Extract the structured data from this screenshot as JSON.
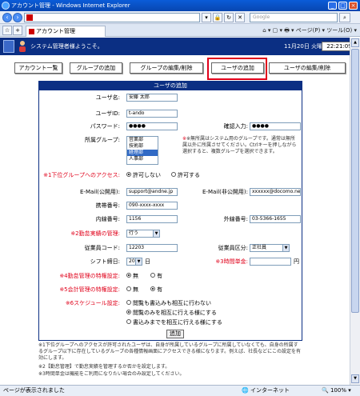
{
  "browser": {
    "title": "アカウント管理 - Windows Internet Explorer",
    "search_placeholder": "Google",
    "tab_label": "アカウント管理",
    "tools_text": "⌂ ▾ ▢ ▾ 🖶 ▾ ページ(P) ▾ ツール(O) ▾",
    "status": "ページが表示されました",
    "zone": "インターネット",
    "zoom": "100%"
  },
  "app": {
    "welcome": "システム管理者様ようこそ。",
    "date": "11月20日 火曜",
    "time": "22:21:09"
  },
  "nav": {
    "account_list": "アカウント一覧",
    "group_add": "グループの追加",
    "group_edit": "グループの編集/削除",
    "user_add": "ユーザの追加",
    "user_edit": "ユーザの編集/削除"
  },
  "form": {
    "header": "ユーザの追加",
    "username_label": "ユーザ名:",
    "username_value": "安藤 太郎",
    "userid_label": "ユーザID:",
    "userid_value": "t-ando",
    "password_label": "パスワード:",
    "password_value": "●●●●",
    "confirm_label": "確認入力:",
    "confirm_value": "●●●●",
    "group_label": "所属グループ:",
    "groups": [
      "営業部",
      "技術部",
      "経理部",
      "人事部"
    ],
    "group_note": "※無所属はシステム用のグループです。通常は無所属以外に所属させてください。Ctrlキーを押しながら選択すると、複数グループを選択できます。",
    "access_label": "※1下位グループへのアクセス:",
    "access_no": "許可しない",
    "access_yes": "許可する",
    "email_public_label": "E-Mail(公開用):",
    "email_public_value": "support@andne.jp",
    "email_private_label": "E-Mail(非公開用):",
    "email_private_value": "xxxxxx@docomo.ne",
    "mobile_label": "携帯番号:",
    "mobile_value": "090-xxxx-xxxx",
    "ext_label": "内線番号:",
    "ext_value": "1156",
    "outer_label": "外線番号:",
    "outer_value": "03-5366-1655",
    "attendance_label": "※2勤怠実績の管理:",
    "attendance_value": "行う",
    "code_label": "従業員コード:",
    "code_value": "12203",
    "category_label": "従業員区分:",
    "category_value": "正社員",
    "cutoff_label": "シフト締日:",
    "cutoff_value": "20",
    "cutoff_unit": "日",
    "hourly_label": "※3時間単金:",
    "hourly_unit": "円",
    "special_label": "※4勤怠管理の特権設定:",
    "special_no": "無",
    "special_yes": "有",
    "account_special_label": "※5会計管理の特権設定:",
    "account_no": "無",
    "account_yes": "有",
    "schedule_label": "※6スケジュール設定:",
    "schedule_opts": [
      "閲覧も書込みも相互に行わない",
      "閲覧のみを相互に行える様にする",
      "書込みまでを相互に行える様にする"
    ],
    "submit": "追加"
  },
  "notes": {
    "note1": "※1下位グループへのアクセスが許可されたユーザは、自身が所属しているグループに所属していなくても、自身の所属するグループ以下に存在しているグループの各種情報画面にアクセスできる様になります。例えば、社長などにこの設定を有効にします。",
    "note2": "※2【勤怠管理】で勤怠実績を管理するか否かを設定します。",
    "note3": "※3時間単金は機能をご利用になりたい場合のみ設定してください。"
  }
}
